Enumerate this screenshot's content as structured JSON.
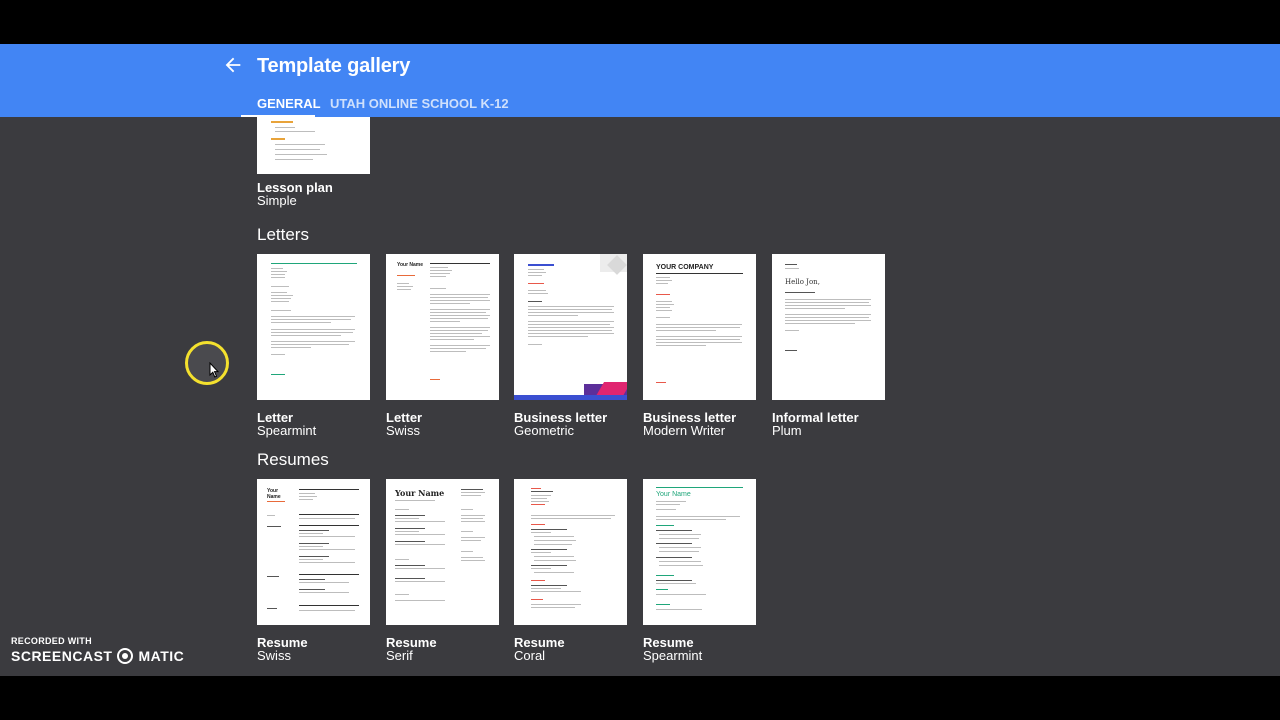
{
  "header": {
    "title": "Template gallery",
    "tabs": [
      {
        "label": "GENERAL",
        "selected": true
      },
      {
        "label": "UTAH ONLINE SCHOOL K-12",
        "selected": false
      }
    ],
    "accent": "#4285f4"
  },
  "partial_card": {
    "name": "Lesson plan",
    "sub": "Simple"
  },
  "sections": [
    {
      "title": "Letters",
      "cards": [
        {
          "name": "Letter",
          "sub": "Spearmint"
        },
        {
          "name": "Letter",
          "sub": "Swiss"
        },
        {
          "name": "Business letter",
          "sub": "Geometric"
        },
        {
          "name": "Business letter",
          "sub": "Modern Writer"
        },
        {
          "name": "Informal letter",
          "sub": "Plum"
        }
      ]
    },
    {
      "title": "Resumes",
      "cards": [
        {
          "name": "Resume",
          "sub": "Swiss"
        },
        {
          "name": "Resume",
          "sub": "Serif"
        },
        {
          "name": "Resume",
          "sub": "Coral"
        },
        {
          "name": "Resume",
          "sub": "Spearmint"
        }
      ]
    }
  ],
  "thumb_text": {
    "swiss_letter_name": "Your Name",
    "modern_writer_company": "YOUR COMPANY",
    "plum_greeting": "Hello Jon,",
    "resume_swiss_name": "Your Name",
    "resume_serif_name": "Your Name",
    "resume_spearmint_name": "Your Name"
  },
  "watermark": {
    "line1": "RECORDED WITH",
    "brand_left": "SCREENCAST",
    "brand_right": "MATIC"
  },
  "colors": {
    "background": "#3b3b3f",
    "cursor_highlight": "#f4e12e",
    "spearmint": "#1fa67a",
    "swiss_accent": "#e86a3a",
    "coral": "#e8584a",
    "geometric": "#5c2f9a"
  }
}
